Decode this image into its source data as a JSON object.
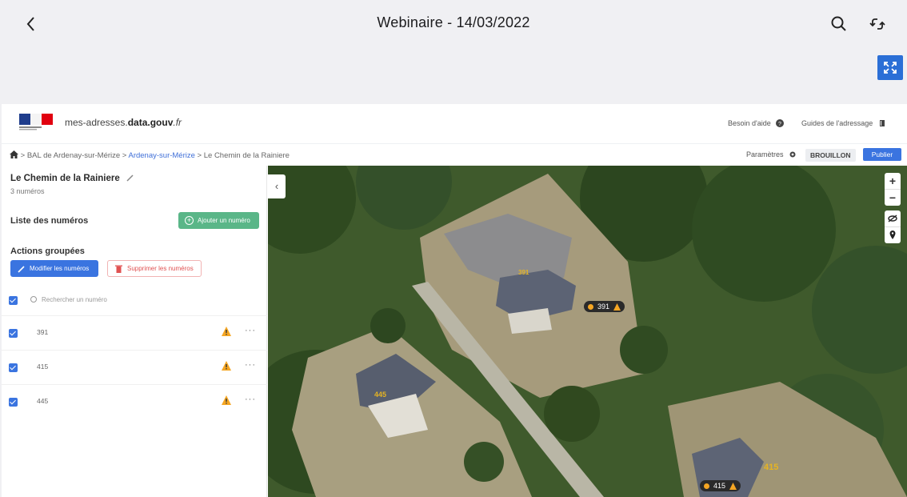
{
  "video": {
    "title": "Webinaire - 14/03/2022"
  },
  "site": {
    "name_prefix": "mes-adresses.",
    "name_bold": "data.gouv",
    "name_suffix": ".fr",
    "help_label": "Besoin d'aide",
    "guides_label": "Guides de l'adressage"
  },
  "breadcrumb": {
    "sep1": " > ",
    "bal": "BAL de Ardenay-sur-Mérize",
    "sep2": " > ",
    "commune": "Ardenay-sur-Mérize",
    "sep3": " > ",
    "street": "Le Chemin de la Rainiere"
  },
  "toolbar": {
    "params_label": "Paramètres",
    "draft_label": "BROUILLON",
    "publish_label": "Publier"
  },
  "panel": {
    "street_name": "Le Chemin de la Rainiere",
    "numbers_count": "3 numéros",
    "list_title": "Liste des numéros",
    "add_label": "Ajouter un numéro",
    "group_title": "Actions groupées",
    "edit_label": "Modifier les numéros",
    "delete_label": "Supprimer les numéros",
    "search_placeholder": "Rechercher un numéro",
    "rows": [
      {
        "number": "391"
      },
      {
        "number": "415"
      },
      {
        "number": "445"
      }
    ]
  },
  "map": {
    "pins": [
      {
        "label": "391"
      },
      {
        "label": "415"
      }
    ],
    "tags": [
      {
        "label": "391"
      },
      {
        "label": "445"
      },
      {
        "label": "415"
      }
    ]
  },
  "colors": {
    "primary": "#3a74e0",
    "success": "#5ab688",
    "danger": "#e05252",
    "warning": "#f5a623"
  },
  "icons": [
    "back-icon",
    "search-icon",
    "sync-icon",
    "fullscreen-icon",
    "home-icon",
    "pencil-icon",
    "warning-icon",
    "more-icon",
    "gear-icon",
    "help-icon",
    "book-icon"
  ]
}
